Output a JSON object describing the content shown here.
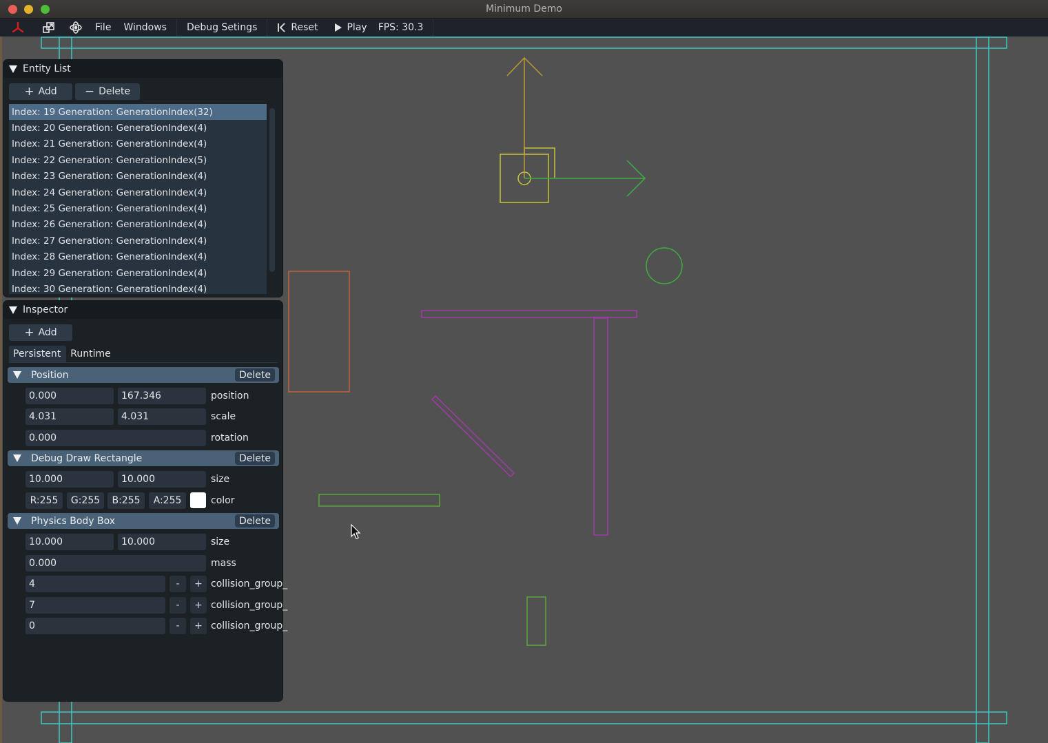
{
  "window": {
    "title": "Minimum Demo",
    "traffic_lights": [
      "close",
      "minimize",
      "maximize"
    ]
  },
  "menubar": {
    "icons": [
      "axis-gizmo-icon",
      "window-restore-icon",
      "orbit-icon"
    ],
    "items": [
      {
        "label": "File"
      },
      {
        "label": "Windows"
      },
      {
        "label": "Debug Setings"
      }
    ],
    "reset_label": "Reset",
    "play_label": "Play",
    "fps": "FPS: 30.3",
    "accent_color": "#d21e1e"
  },
  "entity_list": {
    "title": "Entity List",
    "add_label": "Add",
    "delete_label": "Delete",
    "selected_index": 0,
    "items": [
      "Index: 19 Generation: GenerationIndex(32)",
      "Index: 20 Generation: GenerationIndex(4)",
      "Index: 21 Generation: GenerationIndex(4)",
      "Index: 22 Generation: GenerationIndex(5)",
      "Index: 23 Generation: GenerationIndex(4)",
      "Index: 24 Generation: GenerationIndex(4)",
      "Index: 25 Generation: GenerationIndex(4)",
      "Index: 26 Generation: GenerationIndex(4)",
      "Index: 27 Generation: GenerationIndex(4)",
      "Index: 28 Generation: GenerationIndex(4)",
      "Index: 29 Generation: GenerationIndex(4)",
      "Index: 30 Generation: GenerationIndex(4)"
    ]
  },
  "inspector": {
    "title": "Inspector",
    "add_label": "Add",
    "tabs": [
      {
        "label": "Persistent",
        "active": true
      },
      {
        "label": "Runtime",
        "active": false
      }
    ],
    "delete_label": "Delete",
    "position": {
      "title": "Position",
      "position": [
        "0.000",
        "167.346"
      ],
      "position_label": "position",
      "scale": [
        "4.031",
        "4.031"
      ],
      "scale_label": "scale",
      "rotation": "0.000",
      "rotation_label": "rotation"
    },
    "debug_draw_rectangle": {
      "title": "Debug Draw Rectangle",
      "size": [
        "10.000",
        "10.000"
      ],
      "size_label": "size",
      "color": {
        "r": "R:255",
        "g": "G:255",
        "b": "B:255",
        "a": "A:255",
        "swatch": "#ffffff"
      },
      "color_label": "color"
    },
    "physics_body_box": {
      "title": "Physics Body Box",
      "size": [
        "10.000",
        "10.000"
      ],
      "size_label": "size",
      "mass": "0.000",
      "mass_label": "mass",
      "collision_groups": [
        {
          "value": "4",
          "label": "collision_group_"
        },
        {
          "value": "7",
          "label": "collision_group_"
        },
        {
          "value": "0",
          "label": "collision_group_"
        }
      ],
      "minus_label": "-",
      "plus_label": "+"
    }
  },
  "scene": {
    "background": "#515151",
    "colors": {
      "bounds": "#3cc8c0",
      "gizmo_y": "#b89b2e",
      "gizmo_x": "#3fae3f",
      "selected_box": "#c8c43a",
      "orange_box": "#c0643a",
      "magenta": "#a03aa8",
      "green": "#5aa83a"
    }
  }
}
